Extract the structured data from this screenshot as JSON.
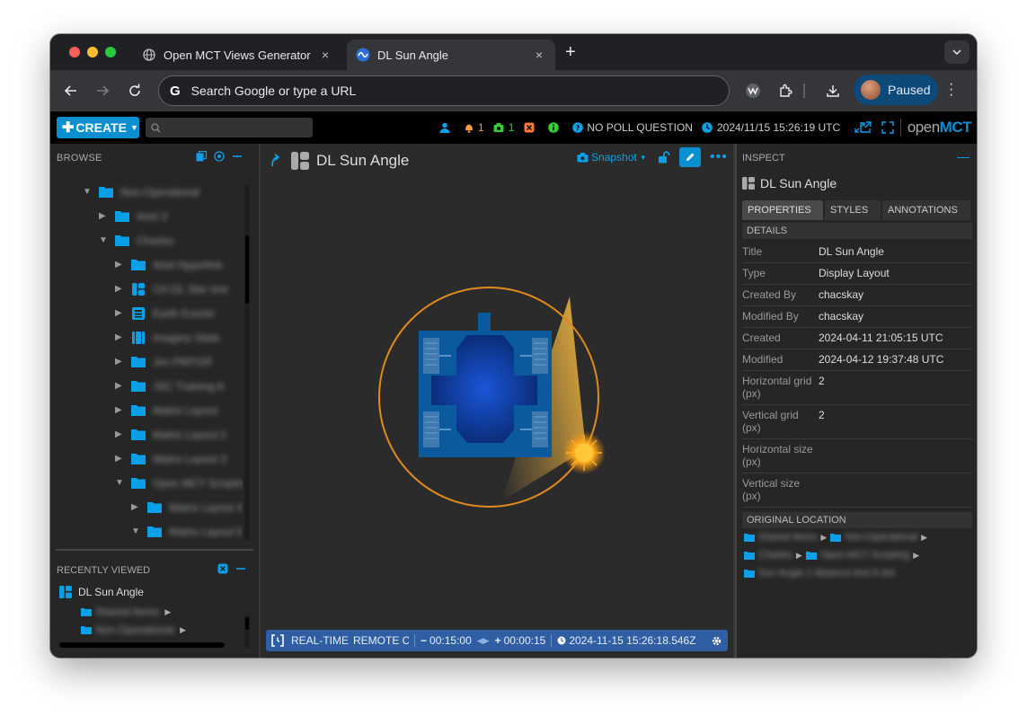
{
  "browser": {
    "tabs": [
      {
        "title": "Open MCT Views Generator",
        "close": "×"
      },
      {
        "title": "DL Sun Angle",
        "close": "×"
      }
    ],
    "new_tab": "+",
    "omnibox_placeholder": "Search Google or type a URL",
    "profile_label": "Paused"
  },
  "appbar": {
    "create_label": "CREATE",
    "indicators": [
      {
        "icon": "user-icon",
        "text": ""
      },
      {
        "icon": "bell-icon",
        "text": "1"
      },
      {
        "icon": "camera-icon",
        "text": "1"
      },
      {
        "icon": "clear-icon",
        "text": ""
      },
      {
        "icon": "info-icon",
        "text": ""
      },
      {
        "icon": "question-icon",
        "text": "NO POLL QUESTION"
      },
      {
        "icon": "clock-icon",
        "text": "2024/11/15 15:26:19 UTC"
      }
    ],
    "brand_open": "open",
    "brand_mct": "MCT"
  },
  "browse": {
    "header": "BROWSE",
    "tree": [
      {
        "label": "Non-Operational",
        "expanded": true
      },
      {
        "label": "Ariel 3",
        "expanded": false
      },
      {
        "label": "Charles",
        "expanded": true
      },
      {
        "label": "Ariel Hyperlink",
        "expanded": false
      },
      {
        "label": "CH DL Star test",
        "expanded": false
      },
      {
        "label": "Earth Events",
        "expanded": false
      },
      {
        "label": "Imagery State",
        "expanded": false
      },
      {
        "label": "Jen PMTGR",
        "expanded": false
      },
      {
        "label": "JSC Training A",
        "expanded": false
      },
      {
        "label": "Matrix Layout",
        "expanded": false
      },
      {
        "label": "Matrix Layout 2",
        "expanded": false
      },
      {
        "label": "Matrix Layout 3",
        "expanded": false
      },
      {
        "label": "Open MCT Scripting",
        "expanded": true
      },
      {
        "label": "Matrix Layout 4",
        "expanded": false
      },
      {
        "label": "Matrix Layout 5",
        "expanded": true
      }
    ]
  },
  "recent": {
    "header": "RECENTLY VIEWED",
    "items": [
      {
        "label": "DL Sun Angle"
      },
      {
        "label": "Shared Items"
      },
      {
        "label": "Non-Operational"
      }
    ]
  },
  "main": {
    "title": "DL Sun Angle",
    "snapshot_label": "Snapshot",
    "timebar": {
      "mode": "REAL-TIME",
      "clock": "REMOTE CL",
      "start_offset": "00:15:00",
      "end_offset": "00:00:15",
      "timestamp": "2024-11-15 15:26:18.546Z"
    }
  },
  "inspector": {
    "header": "INSPECT",
    "object_title": "DL Sun Angle",
    "tabs": [
      "PROPERTIES",
      "STYLES",
      "ANNOTATIONS"
    ],
    "details_header": "DETAILS",
    "properties": [
      {
        "label": "Title",
        "value": "DL Sun Angle"
      },
      {
        "label": "Type",
        "value": "Display Layout"
      },
      {
        "label": "Created By",
        "value": "chacskay"
      },
      {
        "label": "Modified By",
        "value": "chacskay"
      },
      {
        "label": "Created",
        "value": "2024-04-11 21:05:15 UTC"
      },
      {
        "label": "Modified",
        "value": "2024-04-12 19:37:48 UTC"
      },
      {
        "label": "Horizontal grid (px)",
        "value": "2"
      },
      {
        "label": "Vertical grid (px)",
        "value": "2"
      },
      {
        "label": "Horizontal size (px)",
        "value": ""
      },
      {
        "label": "Vertical size (px)",
        "value": ""
      }
    ],
    "location_header": "ORIGINAL LOCATION",
    "location_path": [
      [
        "Shared Items",
        "Non-Operational"
      ],
      [
        "Charles",
        "Open MCT Scripting"
      ],
      [
        "Sun Angle 2 distance test 8 dot"
      ]
    ]
  },
  "colors": {
    "accent": "#0a8fd0",
    "timebar": "#2f5ea3",
    "sun_ring": "#e08a1e"
  }
}
